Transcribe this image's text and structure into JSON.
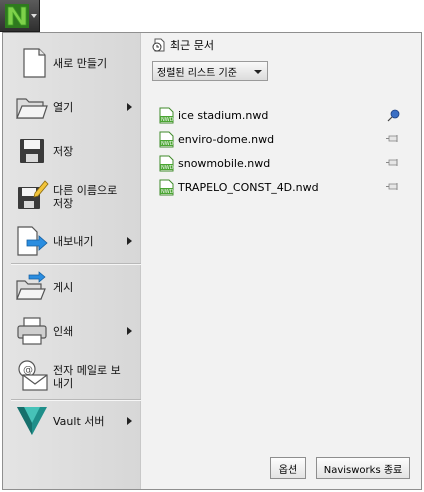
{
  "app_button": {
    "logo_icon": "navisworks-n-logo-icon",
    "accent_color": "#6cbd45"
  },
  "menu": {
    "items": [
      {
        "label": "새로 만들기",
        "icon": "new-document-icon",
        "has_submenu": false
      },
      {
        "label": "열기",
        "icon": "open-folder-icon",
        "has_submenu": true
      },
      {
        "label": "저장",
        "icon": "save-floppy-icon",
        "has_submenu": false
      },
      {
        "label": "다른 이름으로 저장",
        "icon": "save-as-icon",
        "has_submenu": false
      },
      {
        "label": "내보내기",
        "icon": "export-icon",
        "has_submenu": true
      },
      {
        "label": "게시",
        "icon": "publish-icon",
        "has_submenu": false
      },
      {
        "label": "인쇄",
        "icon": "printer-icon",
        "has_submenu": true
      },
      {
        "label": "전자 메일로 보내기",
        "icon": "email-icon",
        "has_submenu": false
      },
      {
        "label": "Vault 서버",
        "icon": "vault-logo-icon",
        "has_submenu": true
      }
    ]
  },
  "recent": {
    "title": "최근 문서",
    "sort_label": "정렬된 리스트 기준",
    "files": [
      {
        "name": "ice stadium.nwd",
        "pinned": true
      },
      {
        "name": "enviro-dome.nwd",
        "pinned": false
      },
      {
        "name": "snowmobile.nwd",
        "pinned": false
      },
      {
        "name": "TRAPELO_CONST_4D.nwd",
        "pinned": false
      }
    ]
  },
  "footer": {
    "options_label": "옵션",
    "exit_label": "Navisworks 종료"
  }
}
